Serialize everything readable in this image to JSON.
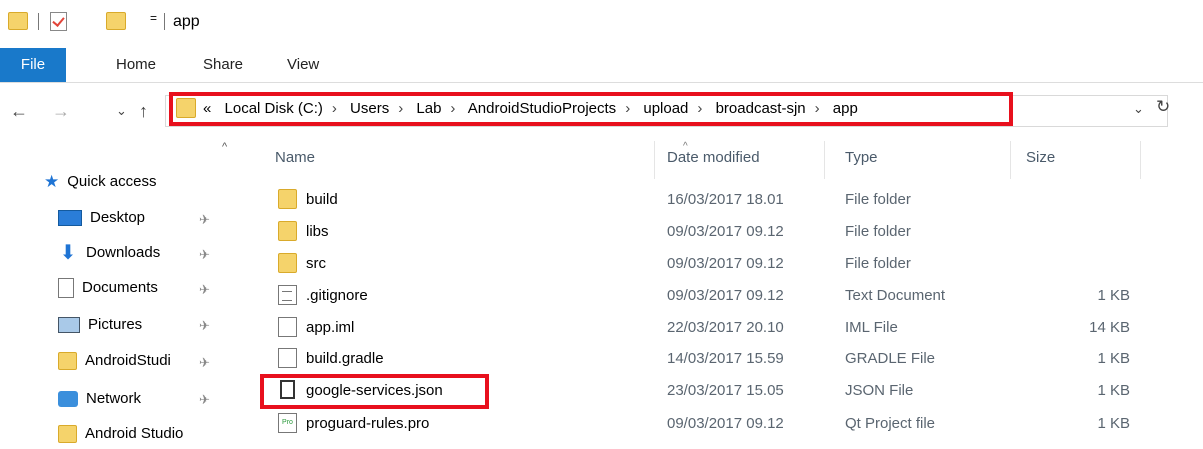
{
  "window": {
    "title": "app",
    "qat_dropdown": "="
  },
  "ribbon": {
    "tabs": [
      "File",
      "Home",
      "Share",
      "View"
    ]
  },
  "navigation": {
    "back": "←",
    "forward": "→",
    "recent": "⌄",
    "up": "↑",
    "address_prefix": "«",
    "breadcrumbs": [
      "Local Disk (C:)",
      "Users",
      "Lab",
      "AndroidStudioProjects",
      "upload",
      "broadcast-sjn",
      "app"
    ],
    "separator": "›",
    "dropdown": "⌄",
    "refresh": "↻"
  },
  "sidebar": {
    "scroll_up": "^",
    "quick_access": "Quick access",
    "items": [
      {
        "label": "Desktop",
        "icon": "desktop-icon",
        "pinned": true
      },
      {
        "label": "Downloads",
        "icon": "downloads-icon",
        "pinned": true
      },
      {
        "label": "Documents",
        "icon": "documents-icon",
        "pinned": true
      },
      {
        "label": "Pictures",
        "icon": "pictures-icon",
        "pinned": true
      },
      {
        "label": "AndroidStudi",
        "icon": "folder-icon",
        "pinned": true
      },
      {
        "label": "Network",
        "icon": "network-icon",
        "pinned": true
      },
      {
        "label": "Android Studio",
        "icon": "folder-icon",
        "pinned": false
      }
    ],
    "pin_glyph": "✈"
  },
  "file_list": {
    "columns": {
      "name": "Name",
      "date": "Date modified",
      "type": "Type",
      "size": "Size"
    },
    "sort_caret": "^",
    "rows": [
      {
        "name": "build",
        "date": "16/03/2017 18.01",
        "type": "File folder",
        "size": "",
        "icon": "folder-icon"
      },
      {
        "name": "libs",
        "date": "09/03/2017 09.12",
        "type": "File folder",
        "size": "",
        "icon": "folder-icon"
      },
      {
        "name": "src",
        "date": "09/03/2017 09.12",
        "type": "File folder",
        "size": "",
        "icon": "folder-icon"
      },
      {
        "name": ".gitignore",
        "date": "09/03/2017 09.12",
        "type": "Text Document",
        "size": "1 KB",
        "icon": "text-file-icon"
      },
      {
        "name": "app.iml",
        "date": "22/03/2017 20.10",
        "type": "IML File",
        "size": "14 KB",
        "icon": "file-icon"
      },
      {
        "name": "build.gradle",
        "date": "14/03/2017 15.59",
        "type": "GRADLE File",
        "size": "1 KB",
        "icon": "file-icon"
      },
      {
        "name": "google-services.json",
        "date": "23/03/2017 15.05",
        "type": "JSON File",
        "size": "1 KB",
        "icon": "json-file-icon"
      },
      {
        "name": "proguard-rules.pro",
        "date": "09/03/2017 09.12",
        "type": "Qt Project file",
        "size": "1 KB",
        "icon": "pro-file-icon"
      }
    ]
  },
  "colors": {
    "accent": "#1979ca",
    "highlight": "#e8101d",
    "folder": "#f5d36b"
  }
}
